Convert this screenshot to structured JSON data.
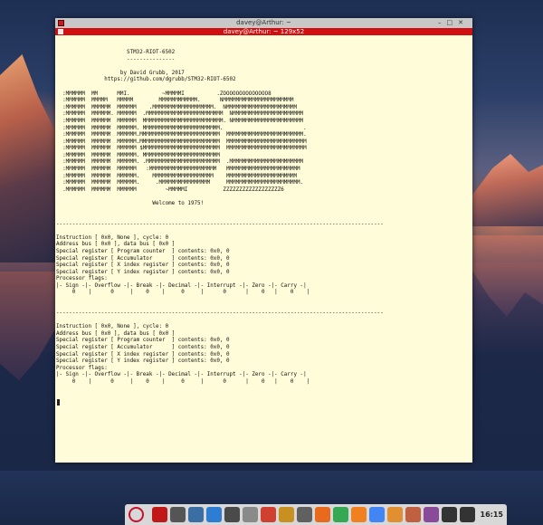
{
  "window": {
    "title": "davey@Arthur: ~",
    "tab_title": "davey@Arthur: ~ 129x52"
  },
  "terminal": {
    "lines": [
      "",
      "",
      "                      STM32-RIOT-6502",
      "                      ---------------",
      "",
      "                    by David Grubb, 2017",
      "               https://github.com/dgrubb/STM32-RIOT-6502",
      "",
      "  :MMMMMM  MM      MMI.          ~MMMMMI          .ZOOOOOOOOOOOOOO8",
      "  :MMMMMM  MMMMM   MMMMM        MMMMMMMMMMMM.      NMMMMMMMMMMMMMMMMMMMMMM",
      "  :MMMMMM  MMMMMM  MMMMMM    .MMMMMMMMMMMMMMMMMMM.  NMMMMMMMMMMMMMMMMMMMMMM",
      "  :MMMMMM  MMMMMM. MMMMMM  .MMMMMMMMMMMMMMMMMMMMMMMM  NMMMMMMMMMMMMMMMMMMMMMM",
      "  :MMMMMM  MMMMMM  MMMMMM  MMMMMMMMMMMMMMMMMMMMMMMMM. NMMMMMMMMMMMMMMMMMMMMMM",
      "  :MMMMMM  MMMMMM  MMMMMM. MMMMMMMMMMMMMMMMMMMMMMMM.                         .",
      "  :MMMMMM  MMMMMM  MMMMMM.MMMMMMMMMMMMMMMMMMMMMMMMM  MMMMMMMMMMMMMMMMMMMMMMMM.",
      "  :MMMMMM  MMMMMM  MMMMMM.MMMMMMMMMMMMMMMMMMMMMMMMM  MMMMMMMMMMMMMMMMMMMMMMMMM",
      "  :MMMMMM  MMMMMM  MMMMMM $MMMMMMMMMMMMMMMMMMMMMMMM  MMMMMMMMMMMMMMMMMMMMMMMMM",
      "  :MMMMMM  MMMMMM  MMMMMM. MMMMMMMMMMMMMMMMMMMMMMMM",
      "  :MMMMMM  MMMMMM  MMMMMM. .MMMMMMMMMMMMMMMMMMMMMMM  .MMMMMMMMMMMMMMMMMMMMMMM",
      "  :MMMMMM  MMMMMM  MMMMMM   :MMMMMMMMMMMMMMMMMMMMM   MMMMMMMMMMMMMMMMMMMMMMM",
      "  :MMMMMM  MMMMMM  MMMMMM.    MMMMMMMMMMMMMMMMMMM    MMMMMMMMMMMMMMMMMMMMMM",
      "  :MMMMMM  MMMMMM  MMMMMM.     .MMMMMMMMMMMMMMMM     MMMMMMMMMMMMMMMMMMMMMMM.",
      "  .MMMMMM  MMMMMM  MMMMMM         ~MMMMMI           ZZZZZZZZZZZZZZZZZZ6",
      "",
      "                              Welcome to 1975!",
      "",
      "",
      "------------------------------------------------------------------------------------------------------",
      "",
      "Instruction [ 0x0, None ], cycle: 0",
      "Address bus [ 0x0 ], data bus [ 0x0 ]",
      "Special register [ Program counter  ] contents: 0x0, 0",
      "Special register [ Accumulator      ] contents: 0x0, 0",
      "Special register [ X index register ] contents: 0x0, 0",
      "Special register [ Y index register ] contents: 0x0, 0",
      "Processor flags:",
      "|- Sign -|- Overflow -|- Break -|- Decimal -|- Interrupt -|- Zero -|- Carry -|",
      "     0    |      0     |    0    |     0     |      0      |    0   |    0    |",
      "",
      "",
      "------------------------------------------------------------------------------------------------------",
      "",
      "Instruction [ 0x0, None ], cycle: 0",
      "Address bus [ 0x0 ], data bus [ 0x0 ]",
      "Special register [ Program counter  ] contents: 0x0, 0",
      "Special register [ Accumulator      ] contents: 0x0, 0",
      "Special register [ X index register ] contents: 0x0, 0",
      "Special register [ Y index register ] contents: 0x0, 0",
      "Processor flags:",
      "|- Sign -|- Overflow -|- Break -|- Decimal -|- Interrupt -|- Zero -|- Carry -|",
      "     0    |      0     |    0    |     0     |      0      |    0   |    0    |"
    ]
  },
  "taskbar": {
    "clock": "16:15",
    "items": [
      {
        "name": "debian-menu-icon",
        "color": "#c8102e"
      },
      {
        "name": "terminal-app-icon",
        "color": "#c01818"
      },
      {
        "name": "screenshot-tool-icon",
        "color": "#555555"
      },
      {
        "name": "text-editor-icon",
        "color": "#3a6ea5"
      },
      {
        "name": "document-viewer-icon",
        "color": "#2d7dd2"
      },
      {
        "name": "file-manager-icon",
        "color": "#4a4a4a"
      },
      {
        "name": "image-viewer-icon",
        "color": "#8a8a8a"
      },
      {
        "name": "pdf-viewer-icon",
        "color": "#d04030"
      },
      {
        "name": "trophy-icon",
        "color": "#c89020"
      },
      {
        "name": "app-launcher-icon",
        "color": "#606060"
      },
      {
        "name": "firefox-icon",
        "color": "#e86a1c"
      },
      {
        "name": "chrome-icon",
        "color": "#34a853"
      },
      {
        "name": "vlc-icon",
        "color": "#f08020"
      },
      {
        "name": "chromium-icon",
        "color": "#4285f4"
      },
      {
        "name": "folder-icon",
        "color": "#e09030"
      },
      {
        "name": "package-manager-icon",
        "color": "#c06040"
      },
      {
        "name": "media-player-icon",
        "color": "#8a4a9a"
      },
      {
        "name": "volume-icon",
        "color": "#333333"
      },
      {
        "name": "network-icon",
        "color": "#333333"
      }
    ]
  }
}
